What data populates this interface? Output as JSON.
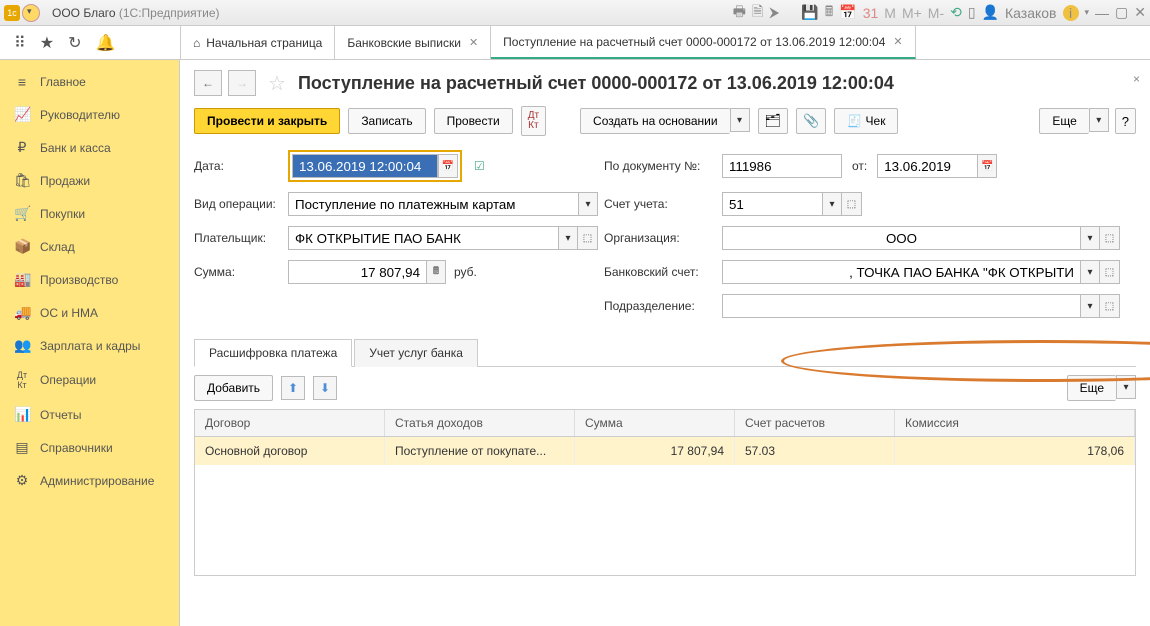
{
  "window": {
    "company": "ООО Благо",
    "app": "(1С:Предприятие)",
    "user": "Казаков"
  },
  "tabs": {
    "home": "Начальная страница",
    "bank": "Банковские выписки",
    "doc": "Поступление на расчетный счет 0000-000172 от 13.06.2019 12:00:04"
  },
  "sidebar": [
    "Главное",
    "Руководителю",
    "Банк и касса",
    "Продажи",
    "Покупки",
    "Склад",
    "Производство",
    "ОС и НМА",
    "Зарплата и кадры",
    "Операции",
    "Отчеты",
    "Справочники",
    "Администрирование"
  ],
  "doc": {
    "title": "Поступление на расчетный счет 0000-000172 от 13.06.2019 12:00:04",
    "actions": {
      "post_close": "Провести и закрыть",
      "save": "Записать",
      "post": "Провести",
      "create_based": "Создать на основании",
      "check": "Чек",
      "more": "Еще"
    },
    "labels": {
      "date": "Дата:",
      "op_type": "Вид операции:",
      "payer": "Плательщик:",
      "sum": "Сумма:",
      "doc_no": "По документу №:",
      "from": "от:",
      "account": "Счет учета:",
      "org": "Организация:",
      "bank_acc": "Банковский счет:",
      "division": "Подразделение:",
      "rub": "руб."
    },
    "values": {
      "date": "13.06.2019 12:00:04",
      "op_type": "Поступление по платежным картам",
      "payer": "ФК ОТКРЫТИЕ ПАО БАНК",
      "sum": "17 807,94",
      "doc_no": "111986",
      "doc_date": "13.06.2019",
      "account": "51",
      "org": "ООО",
      "bank_acc": ", ТОЧКА ПАО БАНКА \"ФК ОТКРЫТИ",
      "division": ""
    },
    "subtabs": {
      "payment": "Расшифровка платежа",
      "bank_services": "Учет услуг банка"
    },
    "add": "Добавить",
    "columns": {
      "contract": "Договор",
      "income": "Статья доходов",
      "sum": "Сумма",
      "acc": "Счет расчетов",
      "commission": "Комиссия"
    },
    "row": {
      "contract": "Основной договор",
      "income": "Поступление от покупате...",
      "sum": "17 807,94",
      "acc": "57.03",
      "commission": "178,06"
    }
  }
}
